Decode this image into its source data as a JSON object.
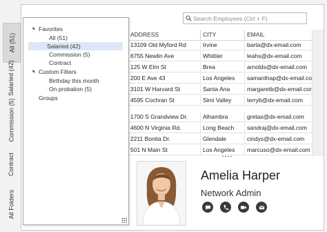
{
  "vertical_tabs": [
    {
      "label": "All (51)",
      "active": true
    },
    {
      "label": "Salaried (42)",
      "active": false
    },
    {
      "label": "Commission (5)",
      "active": false
    },
    {
      "label": "Contract",
      "active": false
    },
    {
      "label": "All Folders",
      "active": false
    }
  ],
  "search": {
    "placeholder": "Search Employees (Ctrl + F)",
    "icon": "search-icon"
  },
  "folders": {
    "favorites_label": "Favorites",
    "favorites": [
      {
        "label": "All (51)",
        "selected": false
      },
      {
        "label": "Salaried (42)",
        "selected": true
      },
      {
        "label": "Commission (5)",
        "selected": false
      },
      {
        "label": "Contract",
        "selected": false
      }
    ],
    "custom_label": "Custom Filters",
    "custom": [
      {
        "label": "Birthday this month"
      },
      {
        "label": "On probation (5)"
      }
    ],
    "groups_label": "Groups"
  },
  "grid": {
    "columns": [
      "ADDRESS",
      "CITY",
      "EMAIL"
    ],
    "rows_top": [
      [
        "13109 Old Myford Rd",
        "Irvine",
        "barta@dx-email.com"
      ],
      [
        "6755 Newlin Ave",
        "Whittier",
        "leahs@dx-email.com"
      ],
      [
        "125 W Elm St",
        "Brea",
        "arnolds@dx-email.com"
      ],
      [
        "200 E Ave 43",
        "Los Angeles",
        "samanthap@dx-email.com"
      ],
      [
        "3101 W Harvard St",
        "Santa Ana",
        "margaretb@dx-email.com"
      ],
      [
        "4595 Cochran St",
        "Simi Valley",
        "terryb@dx-email.com"
      ]
    ],
    "rows_bottom": [
      [
        "1700 S Grandview Dr.",
        "Alhambra",
        "gretas@dx-email.com"
      ],
      [
        "4600 N Virginia Rd.",
        "Long Beach",
        "sandraj@dx-email.com"
      ],
      [
        "2211 Bonita Dr.",
        "Glendale",
        "cindys@dx-email.com"
      ],
      [
        "501 N Main St",
        "Los Angeles",
        "marcuso@dx-email.com"
      ]
    ]
  },
  "detail": {
    "name": "Amelia Harper",
    "title": "Network Admin",
    "actions": [
      "chat-icon",
      "phone-icon",
      "video-icon",
      "email-icon"
    ]
  },
  "colors": {
    "selected": "#dce8f6",
    "button": "#3a3a3a"
  }
}
